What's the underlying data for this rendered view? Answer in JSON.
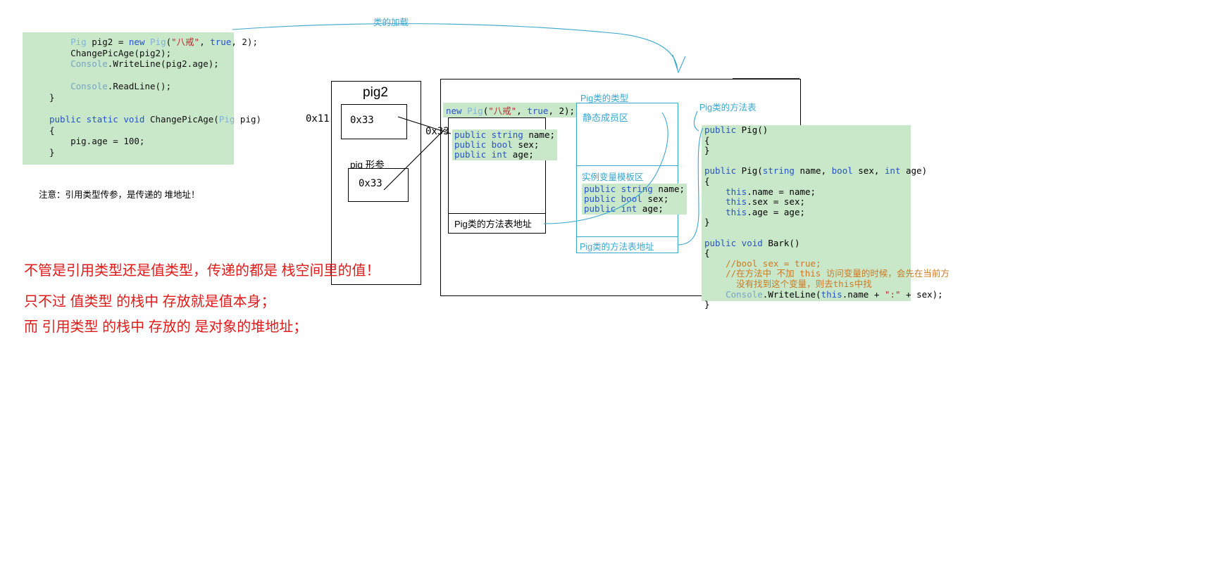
{
  "top_label": "类的加载",
  "code_block": {
    "lines": [
      [
        {
          "t": "    ",
          "c": "p"
        },
        {
          "t": "Pig",
          "c": "cls"
        },
        {
          "t": " pig2 = ",
          "c": "p"
        },
        {
          "t": "new",
          "c": "kw"
        },
        {
          "t": " ",
          "c": "p"
        },
        {
          "t": "Pig",
          "c": "cls"
        },
        {
          "t": "(",
          "c": "p"
        },
        {
          "t": "\"八戒\"",
          "c": "str"
        },
        {
          "t": ", ",
          "c": "p"
        },
        {
          "t": "true",
          "c": "kw"
        },
        {
          "t": ", 2);",
          "c": "p"
        }
      ],
      [
        {
          "t": "    ChangePicAge(pig2);",
          "c": "p"
        }
      ],
      [
        {
          "t": "    ",
          "c": "p"
        },
        {
          "t": "Console",
          "c": "typ"
        },
        {
          "t": ".WriteLine(pig2.age);",
          "c": "p"
        }
      ],
      [
        {
          "t": " ",
          "c": "p"
        }
      ],
      [
        {
          "t": "    ",
          "c": "p"
        },
        {
          "t": "Console",
          "c": "typ"
        },
        {
          "t": ".ReadLine();",
          "c": "p"
        }
      ],
      [
        {
          "t": "}",
          "c": "p"
        }
      ],
      [
        {
          "t": " ",
          "c": "p"
        }
      ],
      [
        {
          "t": "",
          "c": "p"
        },
        {
          "t": "public static void",
          "c": "kw"
        },
        {
          "t": " ChangePicAge(",
          "c": "p"
        },
        {
          "t": "Pig",
          "c": "cls"
        },
        {
          "t": " pig)",
          "c": "p"
        }
      ],
      [
        {
          "t": "{",
          "c": "p"
        }
      ],
      [
        {
          "t": "    pig.age = 100;",
          "c": "p"
        }
      ],
      [
        {
          "t": "}",
          "c": "p"
        }
      ]
    ]
  },
  "note_text": "注意：引用类型传参，是传递的 堆地址！",
  "stack": {
    "title": "pig2",
    "address_label": "0x11",
    "pig2_value": "0x33",
    "param_label": "pig 形参",
    "param_value": "0x33"
  },
  "heap": {
    "address_label": "0x33",
    "new_expression_parts": [
      {
        "t": "new",
        "c": "kw"
      },
      {
        "t": " ",
        "c": "p"
      },
      {
        "t": "Pig",
        "c": "cls"
      },
      {
        "t": "(",
        "c": "p"
      },
      {
        "t": "\"八戒\"",
        "c": "str"
      },
      {
        "t": ", ",
        "c": "p"
      },
      {
        "t": "true",
        "c": "kw"
      },
      {
        "t": ", 2);",
        "c": "p"
      }
    ],
    "object_fields": [
      [
        {
          "t": "public string",
          "c": "kw"
        },
        {
          "t": " name;",
          "c": "p"
        }
      ],
      [
        {
          "t": "public bool",
          "c": "kw"
        },
        {
          "t": " sex;",
          "c": "p"
        }
      ],
      [
        {
          "t": "public int",
          "c": "kw"
        },
        {
          "t": " age;",
          "c": "p"
        }
      ]
    ],
    "method_table_address": "Pig类的方法表地址"
  },
  "class_type": {
    "label": "Pig类的类型",
    "static_area": "静态成员区",
    "instance_area": "实例变量模板区",
    "instance_fields": [
      [
        {
          "t": "public string",
          "c": "kw"
        },
        {
          "t": " name;",
          "c": "p"
        }
      ],
      [
        {
          "t": "public bool",
          "c": "kw"
        },
        {
          "t": " sex;",
          "c": "p"
        }
      ],
      [
        {
          "t": "public int",
          "c": "kw"
        },
        {
          "t": " age;",
          "c": "p"
        }
      ]
    ],
    "method_table_address": "Pig类的方法表地址"
  },
  "method_table": {
    "label": "Pig类的方法表",
    "lines": [
      [
        {
          "t": "public",
          "c": "kw"
        },
        {
          "t": " Pig()",
          "c": "p"
        }
      ],
      [
        {
          "t": "{",
          "c": "p"
        }
      ],
      [
        {
          "t": "}",
          "c": "p"
        }
      ],
      [
        {
          "t": " ",
          "c": "p"
        }
      ],
      [
        {
          "t": "public",
          "c": "kw"
        },
        {
          "t": " Pig(",
          "c": "p"
        },
        {
          "t": "string",
          "c": "kw"
        },
        {
          "t": " name, ",
          "c": "p"
        },
        {
          "t": "bool",
          "c": "kw"
        },
        {
          "t": " sex, ",
          "c": "p"
        },
        {
          "t": "int",
          "c": "kw"
        },
        {
          "t": " age)",
          "c": "p"
        }
      ],
      [
        {
          "t": "{",
          "c": "p"
        }
      ],
      [
        {
          "t": "    ",
          "c": "p"
        },
        {
          "t": "this",
          "c": "kw"
        },
        {
          "t": ".name = name;",
          "c": "p"
        }
      ],
      [
        {
          "t": "    ",
          "c": "p"
        },
        {
          "t": "this",
          "c": "kw"
        },
        {
          "t": ".sex = sex;",
          "c": "p"
        }
      ],
      [
        {
          "t": "    ",
          "c": "p"
        },
        {
          "t": "this",
          "c": "kw"
        },
        {
          "t": ".age = age;",
          "c": "p"
        }
      ],
      [
        {
          "t": "}",
          "c": "p"
        }
      ],
      [
        {
          "t": " ",
          "c": "p"
        }
      ],
      [
        {
          "t": "public void",
          "c": "kw"
        },
        {
          "t": " Bark()",
          "c": "p"
        }
      ],
      [
        {
          "t": "{",
          "c": "p"
        }
      ],
      [
        {
          "t": "    ",
          "c": "p"
        },
        {
          "t": "//bool sex = true;",
          "c": "cmt"
        }
      ],
      [
        {
          "t": "    ",
          "c": "p"
        },
        {
          "t": "//在方法中 不加 this 访问变量的时候，会先在当前方",
          "c": "cmt"
        }
      ],
      [
        {
          "t": "      ",
          "c": "p"
        },
        {
          "t": "没有找到这个变量，则去this中找",
          "c": "cmt"
        }
      ],
      [
        {
          "t": "    ",
          "c": "p"
        },
        {
          "t": "Console",
          "c": "typ"
        },
        {
          "t": ".WriteLine(",
          "c": "p"
        },
        {
          "t": "this",
          "c": "kw"
        },
        {
          "t": ".name + ",
          "c": "p"
        },
        {
          "t": "\":\"",
          "c": "str"
        },
        {
          "t": " + sex);",
          "c": "p"
        }
      ],
      [
        {
          "t": "}",
          "c": "p"
        }
      ]
    ]
  },
  "red_notes": [
    "不管是引用类型还是值类型，传递的都是 栈空间里的值！",
    "只不过 值类型 的栈中 存放就是值本身；",
    "而     引用类型 的栈中 存放的 是对象的堆地址；"
  ],
  "colors": {
    "code_bg": "#c9e7c9",
    "blue_accent": "#3aa7d0",
    "red_note": "#e11a1a",
    "keyword": "#2554c7",
    "string": "#b03030",
    "comment": "#cc7a22"
  }
}
